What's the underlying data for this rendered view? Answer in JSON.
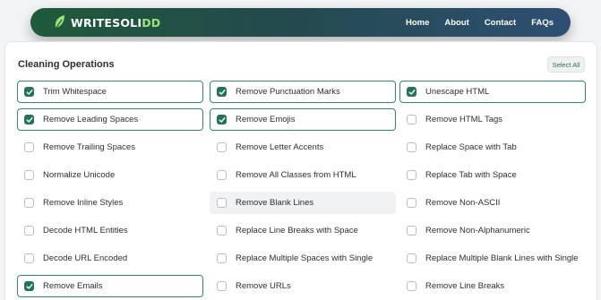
{
  "nav": {
    "brand_main": "WRITESOLI",
    "brand_accent": "DD",
    "links": [
      "Home",
      "About",
      "Contact",
      "FAQs"
    ]
  },
  "panel": {
    "title": "Cleaning Operations",
    "select_all": "Select All"
  },
  "options": [
    {
      "label": "Trim Whitespace",
      "checked": true
    },
    {
      "label": "Remove Punctuation Marks",
      "checked": true
    },
    {
      "label": "Unescape HTML",
      "checked": true
    },
    {
      "label": "Remove Leading Spaces",
      "checked": true
    },
    {
      "label": "Remove Emojis",
      "checked": true
    },
    {
      "label": "Remove HTML Tags",
      "checked": false
    },
    {
      "label": "Remove Trailing Spaces",
      "checked": false
    },
    {
      "label": "Remove Letter Accents",
      "checked": false
    },
    {
      "label": "Replace Space with Tab",
      "checked": false
    },
    {
      "label": "Normalize Unicode",
      "checked": false
    },
    {
      "label": "Remove All Classes from HTML",
      "checked": false
    },
    {
      "label": "Replace Tab with Space",
      "checked": false
    },
    {
      "label": "Remove Inline Styles",
      "checked": false
    },
    {
      "label": "Remove Blank Lines",
      "checked": false,
      "hovered": true
    },
    {
      "label": "Remove Non-ASCII",
      "checked": false
    },
    {
      "label": "Decode HTML Entities",
      "checked": false
    },
    {
      "label": "Replace Line Breaks with Space",
      "checked": false
    },
    {
      "label": "Remove Non-Alphanumeric",
      "checked": false
    },
    {
      "label": "Decode URL Encoded",
      "checked": false
    },
    {
      "label": "Replace Multiple Spaces with Single",
      "checked": false
    },
    {
      "label": "Replace Multiple Blank Lines with Single",
      "checked": false
    },
    {
      "label": "Remove Emails",
      "checked": true
    },
    {
      "label": "Remove URLs",
      "checked": false
    },
    {
      "label": "Remove Line Breaks",
      "checked": false
    }
  ],
  "colors": {
    "accent": "#23735c",
    "nav_gradient_start": "#1f5a3a",
    "nav_gradient_end": "#2e4f73",
    "brand_accent": "#9be27a"
  }
}
